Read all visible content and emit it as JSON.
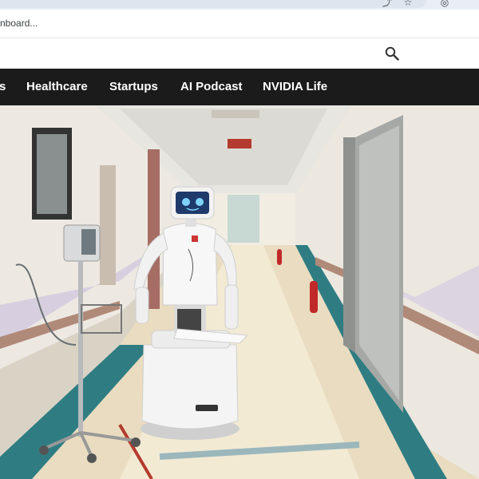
{
  "browser": {
    "bookmark_bar_text": "nboard..."
  },
  "nav": {
    "items": [
      {
        "label": "s"
      },
      {
        "label": "Healthcare"
      },
      {
        "label": "Startups"
      },
      {
        "label": "AI Podcast"
      },
      {
        "label": "NVIDIA Life"
      }
    ]
  },
  "hero": {
    "icon": "hospital-robot-photo"
  },
  "icons": {
    "search": "search-icon",
    "star": "star-icon",
    "profile": "profile-icon"
  },
  "colors": {
    "nav_background": "#1b1b1b",
    "nav_text": "#ffffff"
  }
}
